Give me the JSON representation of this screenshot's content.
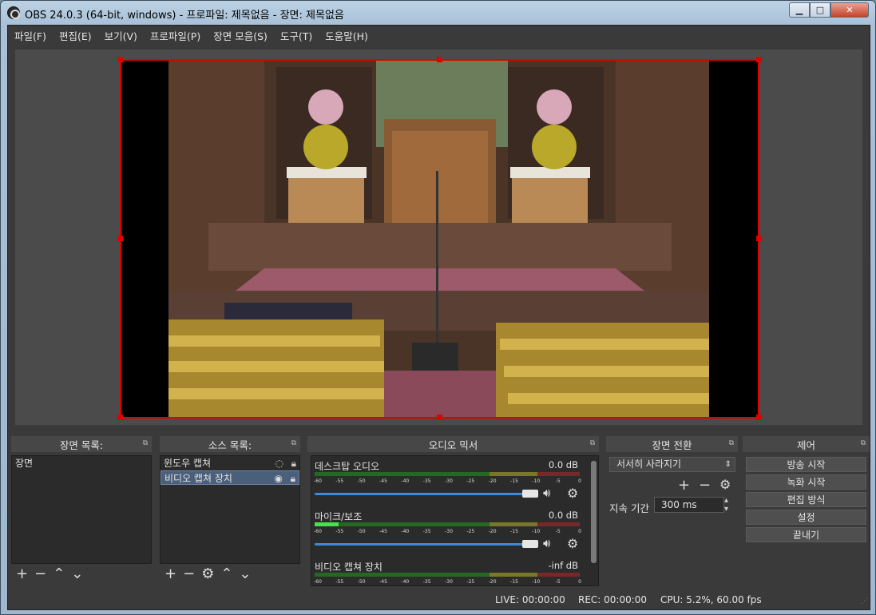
{
  "window": {
    "title": "OBS 24.0.3 (64-bit, windows) - 프로파일: 제목없음 - 장면: 제목없음",
    "controls": {
      "minimize": "▁",
      "maximize": "□",
      "close": "✕"
    }
  },
  "menu": [
    "파일(F)",
    "편집(E)",
    "보기(V)",
    "프로파일(P)",
    "장면 모음(S)",
    "도구(T)",
    "도움말(H)"
  ],
  "scenes": {
    "title": "장면 목록:",
    "items": [
      "장면"
    ]
  },
  "sources": {
    "title": "소스 목록:",
    "items": [
      {
        "label": "윈도우 캡쳐",
        "visible": false,
        "locked": true
      },
      {
        "label": "비디오 캡쳐 장치",
        "visible": true,
        "locked": true,
        "selected": true
      }
    ]
  },
  "mixer": {
    "title": "오디오 믹서",
    "tracks": [
      {
        "name": "데스크탑 오디오",
        "db": "0.0 dB"
      },
      {
        "name": "마이크/보조",
        "db": "0.0 dB"
      },
      {
        "name": "비디오 캡쳐 장치",
        "db": "-inf dB"
      }
    ],
    "tick_labels": [
      "-60",
      "-55",
      "-50",
      "-45",
      "-40",
      "-35",
      "-30",
      "-25",
      "-20",
      "-15",
      "-10",
      "-5",
      "0"
    ]
  },
  "transitions": {
    "title": "장면 전환",
    "selected": "서서히 사라지기",
    "duration_label": "지속 기간",
    "duration_value": "300 ms"
  },
  "controls": {
    "title": "제어",
    "buttons": [
      "방송 시작",
      "녹화 시작",
      "편집 방식",
      "설정",
      "끝내기"
    ]
  },
  "status": {
    "live": "LIVE: 00:00:00",
    "rec": "REC: 00:00:00",
    "cpu": "CPU: 5.2%, 60.00 fps"
  },
  "colors": {
    "accent": "#3f8ad8",
    "selection_frame": "#e00000",
    "panel_bg": "#3a3a3a"
  }
}
